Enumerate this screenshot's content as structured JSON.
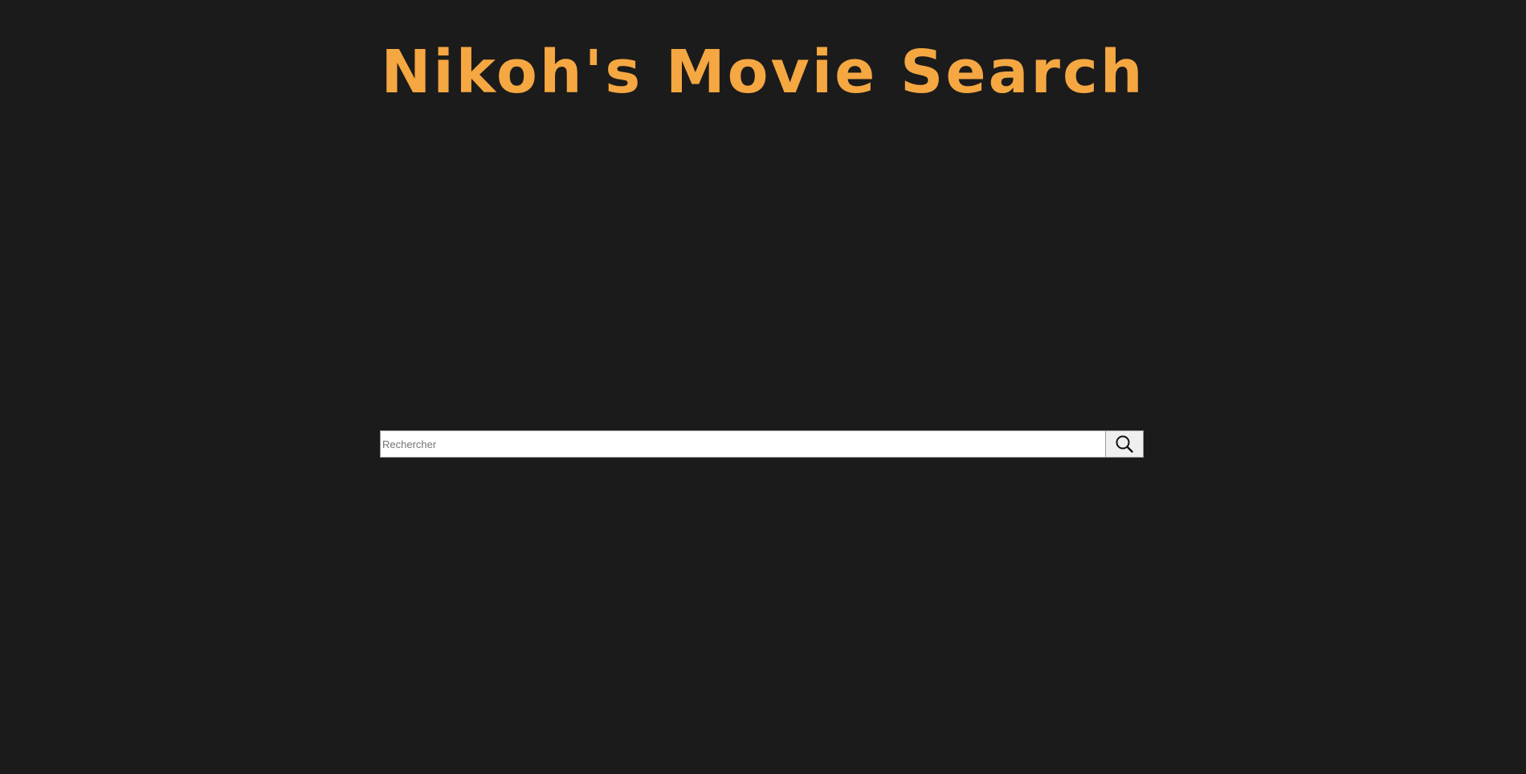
{
  "header": {
    "title": "Nikoh's Movie Search"
  },
  "search": {
    "placeholder": "Rechercher",
    "value": "",
    "button_icon": "search-icon"
  },
  "colors": {
    "background": "#1b1b1b",
    "title": "#f5a742",
    "input_background": "#ffffff",
    "button_background": "#efefef"
  }
}
